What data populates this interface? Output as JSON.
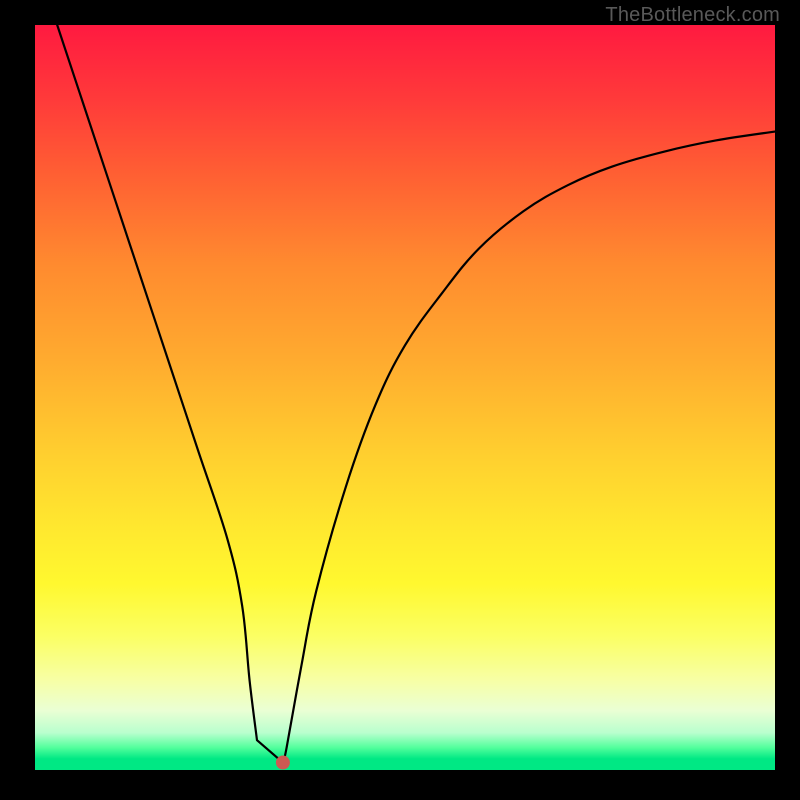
{
  "watermark": "TheBottleneck.com",
  "chart_data": {
    "type": "line",
    "title": "",
    "xlabel": "",
    "ylabel": "",
    "xlim": [
      0,
      100
    ],
    "ylim": [
      0,
      100
    ],
    "grid": false,
    "legend": false,
    "series": [
      {
        "name": "bottleneck-curve",
        "x": [
          3,
          6,
          10,
          14,
          18,
          22,
          26,
          28,
          29,
          30,
          31,
          32,
          33,
          34,
          36,
          38,
          42,
          46,
          50,
          55,
          60,
          66,
          72,
          78,
          85,
          92,
          100
        ],
        "y": [
          100,
          91,
          79,
          67,
          55,
          43,
          31,
          22,
          12,
          4,
          1,
          1,
          1,
          3,
          14,
          24,
          38,
          49,
          57,
          64,
          70,
          75,
          78.5,
          81,
          83,
          84.5,
          85.7
        ]
      }
    ],
    "flat_bottom": {
      "x_start": 30,
      "x_end": 33.5,
      "y": 1
    },
    "marker": {
      "x": 33.5,
      "y": 1,
      "color": "#cc5a52"
    },
    "gradient_stops": [
      {
        "pct": 0,
        "color": "#ff1a40"
      },
      {
        "pct": 10,
        "color": "#ff3a3a"
      },
      {
        "pct": 20,
        "color": "#ff5f33"
      },
      {
        "pct": 32,
        "color": "#ff8a2f"
      },
      {
        "pct": 45,
        "color": "#ffab2f"
      },
      {
        "pct": 58,
        "color": "#ffd02f"
      },
      {
        "pct": 68,
        "color": "#ffe92f"
      },
      {
        "pct": 75,
        "color": "#fff82f"
      },
      {
        "pct": 82,
        "color": "#fbff63"
      },
      {
        "pct": 88,
        "color": "#f7ffa6"
      },
      {
        "pct": 92,
        "color": "#eaffd4"
      },
      {
        "pct": 95,
        "color": "#b9ffce"
      },
      {
        "pct": 97,
        "color": "#52ff9c"
      },
      {
        "pct": 98.5,
        "color": "#00e884"
      },
      {
        "pct": 100,
        "color": "#00e884"
      }
    ]
  }
}
